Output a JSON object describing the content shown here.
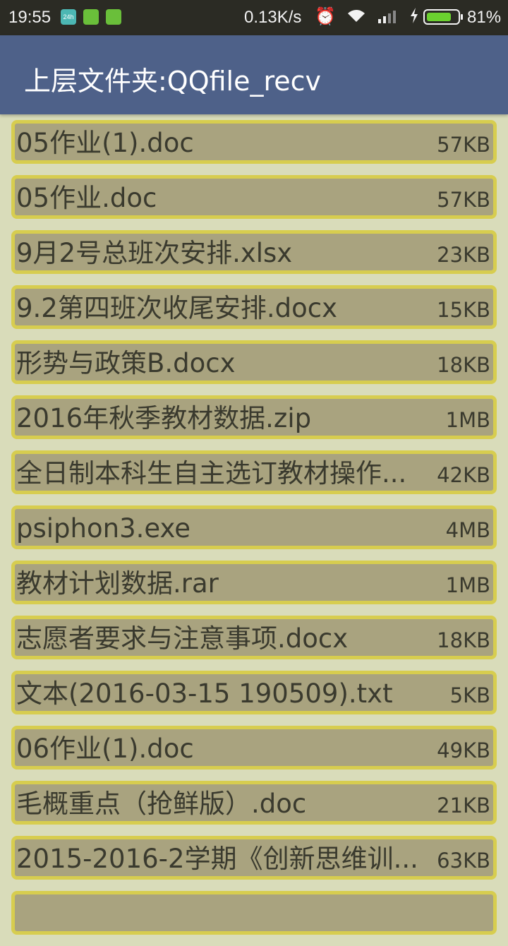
{
  "status_bar": {
    "time": "19:55",
    "notification_icons": [
      "24h-app-icon",
      "battery-saver-icon",
      "android-icon"
    ],
    "net_speed": "0.13K/s",
    "icons": [
      "alarm-icon",
      "wifi-icon",
      "signal-icon",
      "charging-icon"
    ],
    "battery_level": 0.81,
    "battery_text": "81%"
  },
  "app_bar": {
    "title": "上层文件夹:QQfile_recv",
    "color": "#4e6189"
  },
  "files": [
    {
      "name": "05作业(1).doc",
      "size": "57KB"
    },
    {
      "name": "05作业.doc",
      "size": "57KB"
    },
    {
      "name": "9月2号总班次安排.xlsx",
      "size": "23KB"
    },
    {
      "name": "9.2第四班次收尾安排.docx",
      "size": "15KB"
    },
    {
      "name": "形势与政策B.docx",
      "size": "18KB"
    },
    {
      "name": "2016年秋季教材数据.zip",
      "size": "1MB"
    },
    {
      "name": "全日制本科生自主选订教材操作...",
      "size": "42KB"
    },
    {
      "name": "psiphon3.exe",
      "size": "4MB"
    },
    {
      "name": "教材计划数据.rar",
      "size": "1MB"
    },
    {
      "name": "志愿者要求与注意事项.docx",
      "size": "18KB"
    },
    {
      "name": "文本(2016-03-15 190509).txt",
      "size": "5KB"
    },
    {
      "name": "06作业(1).doc",
      "size": "49KB"
    },
    {
      "name": "毛概重点（抢鲜版）.doc",
      "size": "21KB"
    },
    {
      "name": "2015-2016-2学期《创新思维训...",
      "size": "63KB"
    },
    {
      "name": "",
      "size": ""
    }
  ]
}
